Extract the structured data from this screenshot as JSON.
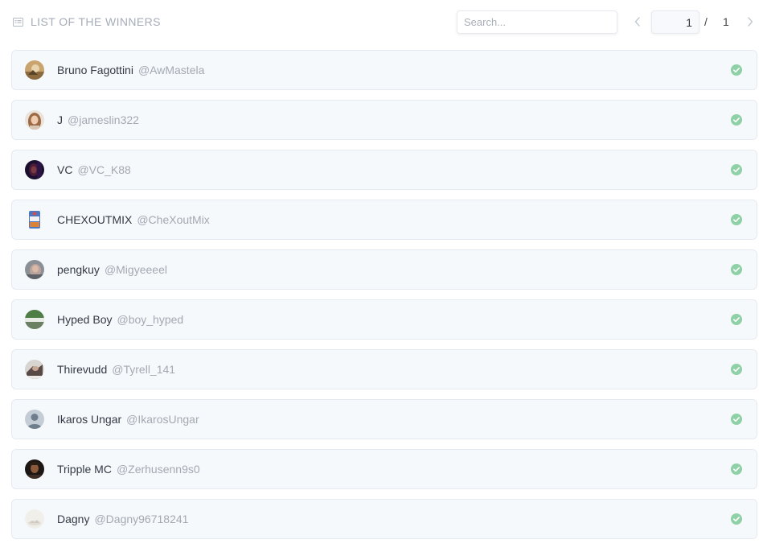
{
  "header": {
    "title": "LIST OF THE WINNERS",
    "icon": "list-icon"
  },
  "search": {
    "placeholder": "Search...",
    "value": ""
  },
  "pagination": {
    "current": "1",
    "separator": "/",
    "total": "1"
  },
  "colors": {
    "check": "#8fd1a6",
    "row_bg": "#f6f9fc",
    "row_border": "#e5eaf0",
    "muted": "#a6adb8"
  },
  "winners": [
    {
      "name": "Bruno Fagottini",
      "handle": "@AwMastela"
    },
    {
      "name": "J",
      "handle": "@jameslin322"
    },
    {
      "name": "VC",
      "handle": "@VC_K88"
    },
    {
      "name": "CHEXOUTMIX",
      "handle": "@CheXoutMix"
    },
    {
      "name": "pengkuy",
      "handle": "@Migyeeeel"
    },
    {
      "name": "Hyped Boy",
      "handle": "@boy_hyped"
    },
    {
      "name": "Thirevudd",
      "handle": "@Tyrell_141"
    },
    {
      "name": "Ikaros Ungar",
      "handle": "@IkarosUngar"
    },
    {
      "name": "Tripple MC",
      "handle": "@Zerhusenn9s0"
    },
    {
      "name": "Dagny",
      "handle": "@Dagny96718241"
    }
  ]
}
